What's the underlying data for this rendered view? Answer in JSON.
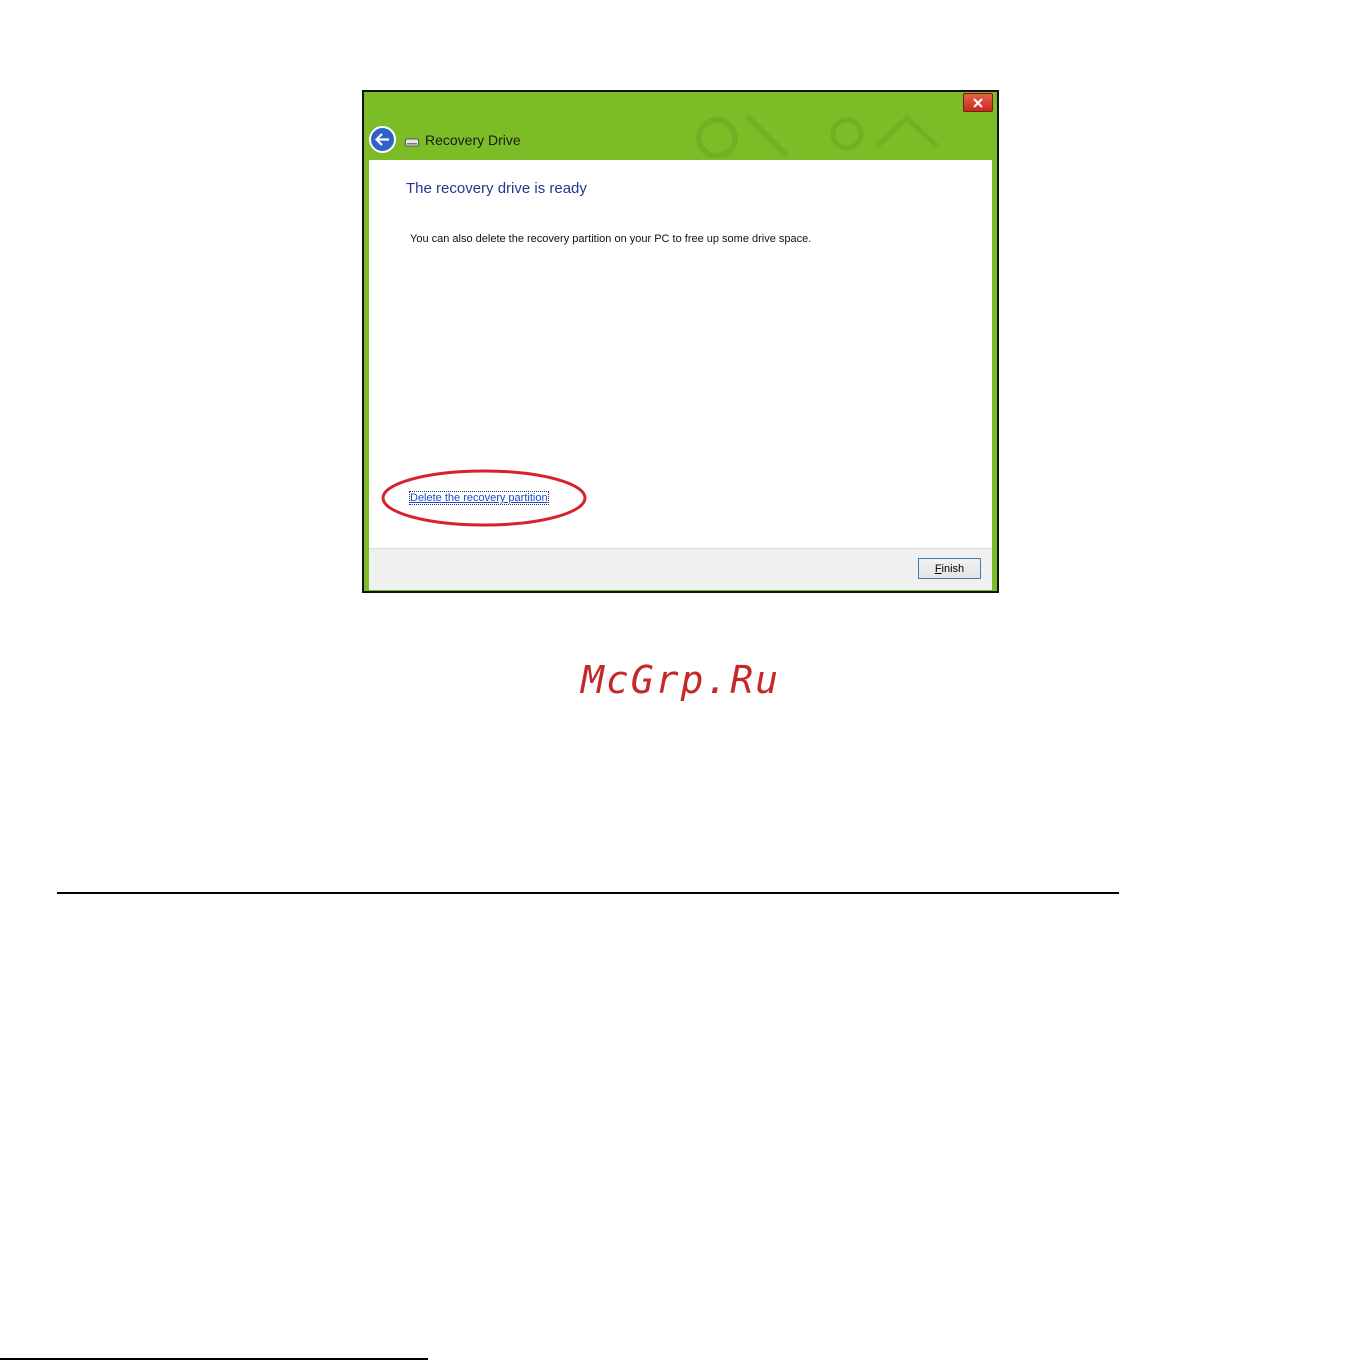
{
  "window": {
    "title": "Recovery Drive",
    "close_label": "x",
    "heading": "The recovery drive is ready",
    "body_text": "You can also delete the recovery partition on your PC to free up some drive space.",
    "delete_link": "Delete the recovery partition",
    "finish": {
      "mnemonic": "F",
      "rest": "inish"
    },
    "colors": {
      "title_bar": "#7cbd27",
      "heading": "#26358f",
      "link": "#1a4ad2",
      "highlight": "#d6212e"
    },
    "icons": [
      "back-arrow-icon",
      "drive-icon",
      "close-icon"
    ]
  },
  "watermark": "McGrp.Ru"
}
